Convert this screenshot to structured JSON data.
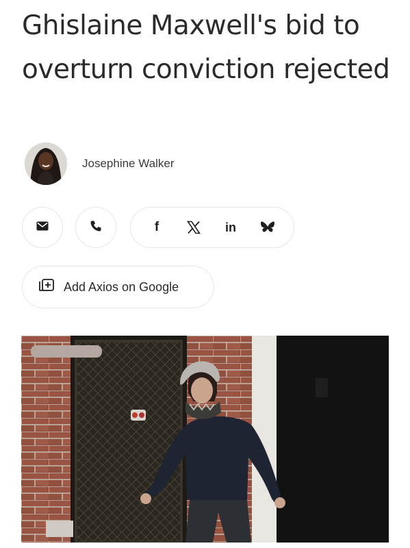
{
  "article": {
    "headline": "Ghislaine Maxwell's bid to overturn conviction rejected",
    "author": "Josephine Walker"
  },
  "share": {
    "email_icon": "envelope-icon",
    "phone_icon": "phone-icon",
    "facebook_glyph": "f",
    "x_glyph": "𝕏",
    "linkedin_glyph": "in",
    "bluesky_icon": "butterfly-icon"
  },
  "google_button": {
    "label": "Add Axios on Google",
    "icon": "add-source-icon"
  },
  "photo": {
    "subject": "woman-walking-photo"
  }
}
